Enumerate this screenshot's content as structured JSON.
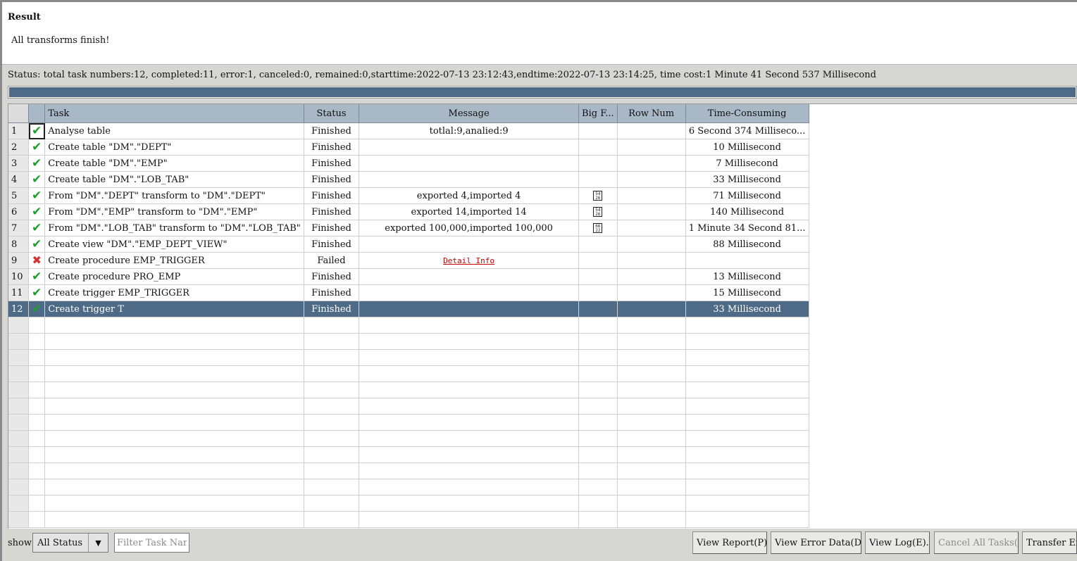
{
  "result": {
    "title": "Result",
    "message": "All transforms finish!"
  },
  "status_line": "Status: total task numbers:12, completed:11, error:1, canceled:0, remained:0,starttime:2022-07-13 23:12:43,endtime:2022-07-13 23:14:25, time cost:1 Minute 41 Second 537 Millisecond",
  "progress": {
    "fraction": 1.0
  },
  "table": {
    "headers": {
      "task": "Task",
      "status": "Status",
      "message": "Message",
      "bigfile": "Big F...",
      "rownum": "Row Num",
      "time": "Time-Consuming"
    },
    "rows": [
      {
        "num": "1",
        "icon": "check-icon",
        "task": "Analyse table",
        "status": "Finished",
        "message": "totlal:9,analied:9",
        "bigfile": "",
        "rownum": "",
        "time": "6 Second 374 Milliseco..."
      },
      {
        "num": "2",
        "icon": "check-icon",
        "task": "Create table \"DM\".\"DEPT\"",
        "status": "Finished",
        "message": "",
        "bigfile": "",
        "rownum": "",
        "time": "10 Millisecond"
      },
      {
        "num": "3",
        "icon": "check-icon",
        "task": "Create table \"DM\".\"EMP\"",
        "status": "Finished",
        "message": "",
        "bigfile": "",
        "rownum": "",
        "time": "7 Millisecond"
      },
      {
        "num": "4",
        "icon": "check-icon",
        "task": "Create table \"DM\".\"LOB_TAB\"",
        "status": "Finished",
        "message": "",
        "bigfile": "",
        "rownum": "",
        "time": "33 Millisecond"
      },
      {
        "num": "5",
        "icon": "check-icon",
        "task": "From \"DM\".\"DEPT\" transform to \"DM\".\"DEPT\"",
        "status": "Finished",
        "message": "exported 4,imported 4",
        "bigfile": "54 26",
        "rownum": "",
        "time": "71 Millisecond"
      },
      {
        "num": "6",
        "icon": "check-icon",
        "task": "From \"DM\".\"EMP\" transform to \"DM\".\"EMP\"",
        "status": "Finished",
        "message": "exported 14,imported 14",
        "bigfile": "54 26",
        "rownum": "",
        "time": "140 Millisecond"
      },
      {
        "num": "7",
        "icon": "check-icon",
        "task": "From \"DM\".\"LOB_TAB\" transform to \"DM\".\"LOB_TAB\"",
        "status": "Finished",
        "message": "exported 100,000,imported 100,000",
        "bigfile": "66 22",
        "rownum": "",
        "time": "1 Minute 34 Second 81..."
      },
      {
        "num": "8",
        "icon": "check-icon",
        "task": "Create view \"DM\".\"EMP_DEPT_VIEW\"",
        "status": "Finished",
        "message": "",
        "bigfile": "",
        "rownum": "",
        "time": "88 Millisecond"
      },
      {
        "num": "9",
        "icon": "cross-icon",
        "task": "Create procedure EMP_TRIGGER",
        "status": "Failed",
        "message": "Detail Info",
        "bigfile": "",
        "rownum": "",
        "time": ""
      },
      {
        "num": "10",
        "icon": "check-icon",
        "task": "Create procedure PRO_EMP",
        "status": "Finished",
        "message": "",
        "bigfile": "",
        "rownum": "",
        "time": "13 Millisecond"
      },
      {
        "num": "11",
        "icon": "check-icon",
        "task": "Create trigger EMP_TRIGGER",
        "status": "Finished",
        "message": "",
        "bigfile": "",
        "rownum": "",
        "time": "15 Millisecond"
      },
      {
        "num": "12",
        "icon": "check-icon",
        "task": "Create trigger T",
        "status": "Finished",
        "message": "",
        "bigfile": "",
        "rownum": "",
        "time": "33 Millisecond"
      }
    ],
    "selected_row": "12"
  },
  "filter": {
    "show_label": "show",
    "status_value": "All Status",
    "task_placeholder": "Filter Task Name"
  },
  "buttons": {
    "view_report": "View Report(P)...",
    "view_error_data": "View Error Data(D)...",
    "view_log": "View Log(E)...",
    "cancel_all": "Cancel All Tasks(S)",
    "transfer_errors": "Transfer Errors"
  }
}
